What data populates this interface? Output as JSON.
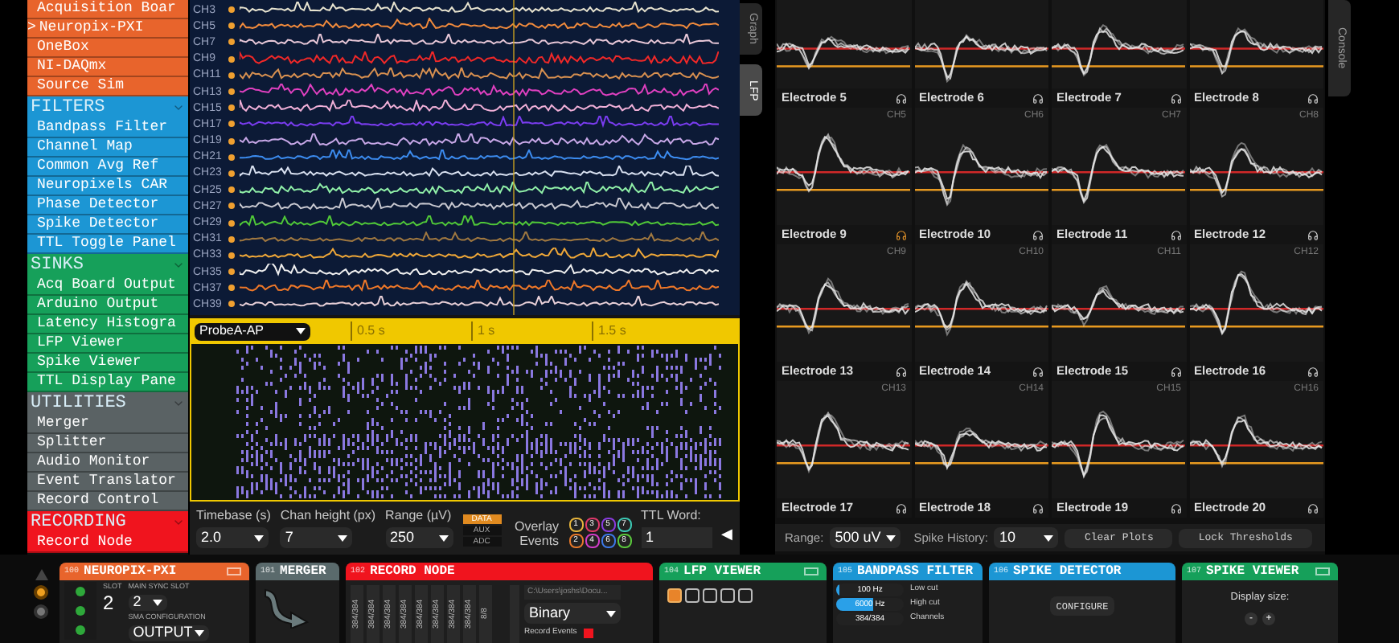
{
  "sidebar": {
    "categories": [
      {
        "color": "#e8642c",
        "items": [
          {
            "label": "Acquisition Boar"
          },
          {
            "label": "Neuropix-PXI",
            "prefix": ">"
          },
          {
            "label": "OneBox"
          },
          {
            "label": "NI-DAQmx"
          },
          {
            "label": "Source Sim"
          }
        ]
      },
      {
        "title": "FILTERS",
        "expanded": true,
        "color": "#1c96d4",
        "items": [
          {
            "label": "Bandpass Filter"
          },
          {
            "label": "Channel Map"
          },
          {
            "label": "Common Avg Ref"
          },
          {
            "label": "Neuropixels CAR"
          },
          {
            "label": "Phase Detector"
          },
          {
            "label": "Spike Detector"
          },
          {
            "label": "TTL Toggle Panel"
          }
        ]
      },
      {
        "title": "SINKS",
        "expanded": true,
        "color": "#16a05a",
        "items": [
          {
            "label": "Acq Board Output"
          },
          {
            "label": "Arduino Output"
          },
          {
            "label": "Latency Histogra"
          },
          {
            "label": "LFP Viewer"
          },
          {
            "label": "Spike Viewer"
          },
          {
            "label": "TTL Display Pane"
          }
        ]
      },
      {
        "title": "UTILITIES",
        "expanded": true,
        "color": "#5a6264",
        "items": [
          {
            "label": "Merger"
          },
          {
            "label": "Splitter"
          },
          {
            "label": "Audio Monitor"
          },
          {
            "label": "Event Translator"
          },
          {
            "label": "Record Control"
          }
        ]
      },
      {
        "title": "RECORDING",
        "expanded": true,
        "color": "#f0141e",
        "items": [
          {
            "label": "Record Node"
          }
        ]
      }
    ]
  },
  "lfp_viewer": {
    "vertical_tabs": [
      {
        "label": "Graph",
        "selected": false
      },
      {
        "label": "LFP",
        "selected": true
      }
    ],
    "channels": [
      {
        "label": "CH3",
        "color": "#e8e4d0"
      },
      {
        "label": "CH5",
        "color": "#f08a3c"
      },
      {
        "label": "CH7",
        "color": "#e8c8d8"
      },
      {
        "label": "CH9",
        "color": "#f02828"
      },
      {
        "label": "CH11",
        "color": "#d89050"
      },
      {
        "label": "CH13",
        "color": "#e040c0"
      },
      {
        "label": "CH15",
        "color": "#f0b0d8"
      },
      {
        "label": "CH17",
        "color": "#7a3cf0"
      },
      {
        "label": "CH19",
        "color": "#c8a8e8"
      },
      {
        "label": "CH21",
        "color": "#3c8cf0"
      },
      {
        "label": "CH23",
        "color": "#d8e0f0"
      },
      {
        "label": "CH25",
        "color": "#90f0a8"
      },
      {
        "label": "CH27",
        "color": "#c8c8d0"
      },
      {
        "label": "CH29",
        "color": "#50c838"
      },
      {
        "label": "CH31",
        "color": "#a07840"
      },
      {
        "label": "CH33",
        "color": "#f0a838"
      },
      {
        "label": "CH35",
        "color": "#f0f0f0"
      },
      {
        "label": "CH37",
        "color": "#f07828"
      },
      {
        "label": "CH39",
        "color": "#e8d0d8"
      }
    ],
    "timeline": {
      "stream": "ProbeA-AP",
      "ticks": [
        "0.5 s",
        "1 s",
        "1.5 s"
      ]
    },
    "controls": {
      "timebase": {
        "label": "Timebase (s)",
        "value": "2.0"
      },
      "chan_height": {
        "label": "Chan height (px)",
        "value": "7"
      },
      "range": {
        "label": "Range (µV)",
        "value": "250"
      },
      "signal_types": [
        {
          "label": "DATA",
          "selected": true
        },
        {
          "label": "AUX",
          "selected": false
        },
        {
          "label": "ADC",
          "selected": false
        }
      ],
      "overlay_label": "Overlay Events",
      "events": [
        {
          "label": "1",
          "color": "#e6b43c"
        },
        {
          "label": "2",
          "color": "#e6782a"
        },
        {
          "label": "3",
          "color": "#e0386a"
        },
        {
          "label": "4",
          "color": "#d23cc8"
        },
        {
          "label": "5",
          "color": "#8a3ce0"
        },
        {
          "label": "6",
          "color": "#3c78e6"
        },
        {
          "label": "7",
          "color": "#3cc8b4"
        },
        {
          "label": "8",
          "color": "#5ac83c"
        }
      ],
      "ttl_word": {
        "label": "TTL Word:",
        "value": "1"
      },
      "collapse_button": "◀"
    }
  },
  "spike_viewer": {
    "electrodes": [
      {
        "kind": "plot"
      },
      {
        "kind": "plot"
      },
      {
        "kind": "plot"
      },
      {
        "kind": "plot"
      },
      {
        "kind": "full",
        "name": "Electrode 5",
        "channel": "CH5",
        "monitored": false
      },
      {
        "kind": "full",
        "name": "Electrode 6",
        "channel": "CH6",
        "monitored": false
      },
      {
        "kind": "full",
        "name": "Electrode 7",
        "channel": "CH7",
        "monitored": false
      },
      {
        "kind": "full",
        "name": "Electrode 8",
        "channel": "CH8",
        "monitored": false
      },
      {
        "kind": "full",
        "name": "Electrode 9",
        "channel": "CH9",
        "monitored": true
      },
      {
        "kind": "full",
        "name": "Electrode 10",
        "channel": "CH10",
        "monitored": false
      },
      {
        "kind": "full",
        "name": "Electrode 11",
        "channel": "CH11",
        "monitored": false
      },
      {
        "kind": "full",
        "name": "Electrode 12",
        "channel": "CH12",
        "monitored": false
      },
      {
        "kind": "full",
        "name": "Electrode 13",
        "channel": "CH13",
        "monitored": false
      },
      {
        "kind": "full",
        "name": "Electrode 14",
        "channel": "CH14",
        "monitored": false
      },
      {
        "kind": "full",
        "name": "Electrode 15",
        "channel": "CH15",
        "monitored": false
      },
      {
        "kind": "full",
        "name": "Electrode 16",
        "channel": "CH16",
        "monitored": false
      },
      {
        "kind": "header",
        "name": "Electrode 17",
        "monitored": false
      },
      {
        "kind": "header",
        "name": "Electrode 18",
        "monitored": false
      },
      {
        "kind": "header",
        "name": "Electrode 19",
        "monitored": false
      },
      {
        "kind": "header",
        "name": "Electrode 20",
        "monitored": false
      }
    ],
    "controls": {
      "range_label": "Range:",
      "range": "500 uV",
      "history_label": "Spike History:",
      "history": "10",
      "buttons": [
        "Clear Plots",
        "Lock Thresholds"
      ]
    }
  },
  "console_tab": "Console",
  "editors": [
    {
      "kind": "neuropix",
      "id": "100",
      "title": "NEUROPIX-PXI",
      "color": "#e8642c",
      "tab_button": true,
      "slot_label": "SLOT",
      "slot": "2",
      "sync_label": "MAIN SYNC SLOT",
      "sync": "2",
      "sma_label": "SMA CONFIGURATION",
      "sma": "OUTPUT",
      "leds": [
        {
          "on": true
        },
        {
          "on": true
        },
        {
          "on": true
        }
      ]
    },
    {
      "kind": "merger",
      "id": "101",
      "title": "MERGER",
      "color": "#5a6a6c"
    },
    {
      "kind": "record",
      "id": "102",
      "title": "RECORD NODE",
      "color": "#f0141e",
      "streams": [
        "384/384",
        "384/384",
        "384/384",
        "384/384",
        "384/384",
        "384/384",
        "384/384",
        "384/384",
        "8/8"
      ],
      "path": "C:\\Users\\joshs\\Docu...",
      "format": "Binary",
      "events_label": "Record Events",
      "record_events": true
    },
    {
      "kind": "lfp",
      "id": "104",
      "title": "LFP VIEWER",
      "color": "#16a05a",
      "tab_button": true,
      "layouts": [
        {
          "selected": true
        },
        {
          "selected": false
        },
        {
          "selected": false
        },
        {
          "selected": false
        },
        {
          "selected": false
        }
      ]
    },
    {
      "kind": "bandpass",
      "id": "105",
      "title": "BANDPASS FILTER",
      "color": "#1c96d4",
      "rows": [
        {
          "value": "100 Hz",
          "label": "Low cut",
          "level": 0.05
        },
        {
          "value": "6000 Hz",
          "label": "High cut",
          "level": 0.55
        },
        {
          "value": "384/384",
          "label": "Channels"
        }
      ]
    },
    {
      "kind": "detector",
      "id": "106",
      "title": "SPIKE DETECTOR",
      "color": "#1c96d4",
      "button": "CONFIGURE"
    },
    {
      "kind": "spikeviewer",
      "id": "107",
      "title": "SPIKE VIEWER",
      "color": "#16a05a",
      "tab_button": true,
      "display_label": "Display size:",
      "buttons": [
        "-",
        "+"
      ]
    }
  ]
}
